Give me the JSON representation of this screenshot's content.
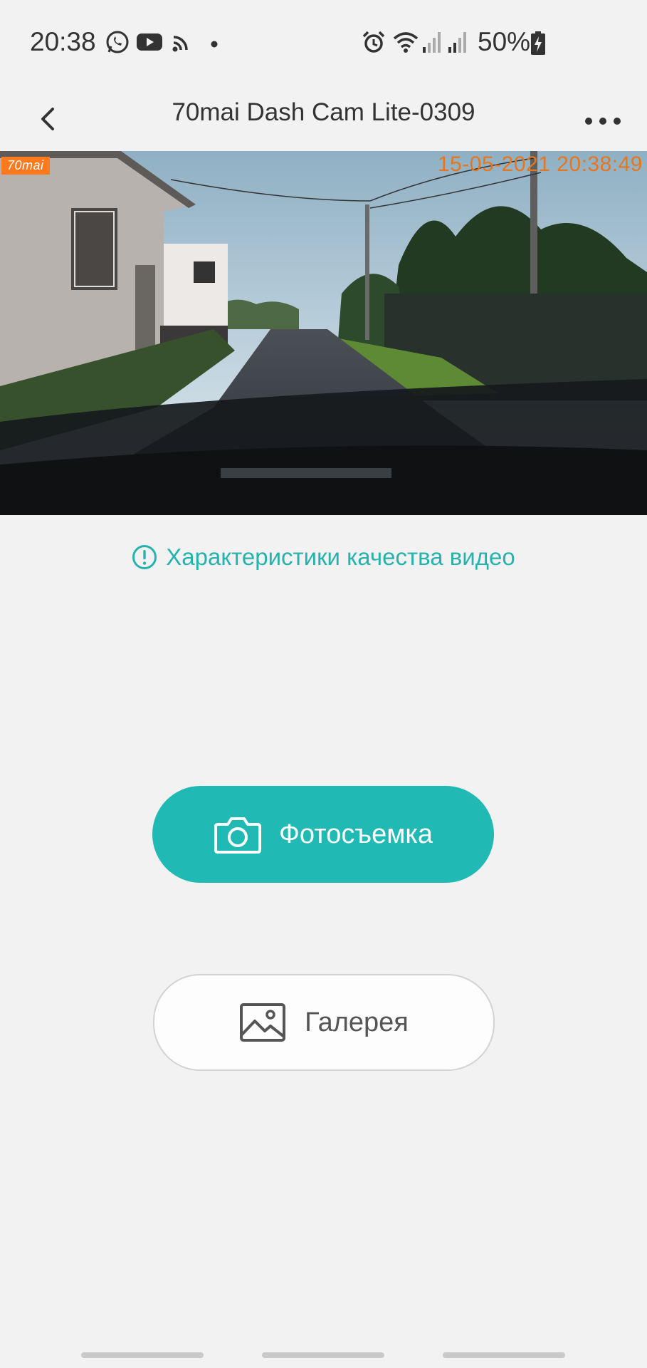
{
  "status_bar": {
    "time": "20:38",
    "battery": "50%",
    "icons": [
      "whatsapp-icon",
      "youtube-icon",
      "cast-icon",
      "dot-icon",
      "alarm-icon",
      "wifi-icon",
      "signal-icon",
      "signal-icon",
      "battery-charging-icon"
    ]
  },
  "app_bar": {
    "title": "70mai Dash Cam Lite-0309",
    "back_icon": "chevron-left-icon",
    "more_icon": "more-horizontal-icon"
  },
  "video": {
    "brand_badge": "70mai",
    "timestamp": "15-05-2021 20:38:49"
  },
  "quality_link": {
    "label": "Характеристики качества видео",
    "icon": "info-circle-icon"
  },
  "photo_button": {
    "label": "Фотосъемка",
    "icon": "camera-icon"
  },
  "gallery_button": {
    "label": "Галерея",
    "icon": "image-icon"
  },
  "colors": {
    "accent": "#21b9b3",
    "link": "#26b3ad",
    "timestamp": "#e8761c",
    "brand": "#ff7a1f",
    "background": "#f2f2f2"
  }
}
